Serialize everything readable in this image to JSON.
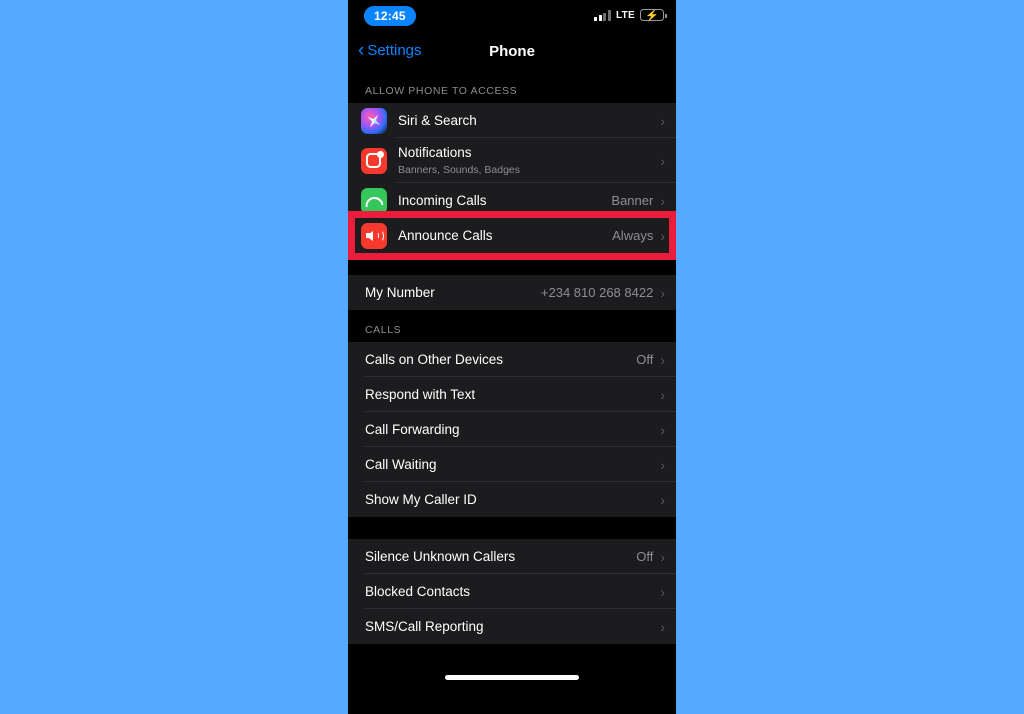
{
  "status_bar": {
    "time": "12:45",
    "carrier_network": "LTE",
    "signal_icon": "cellular-signal-icon",
    "battery_icon": "battery-charging-icon",
    "battery_color": "#32d74b"
  },
  "nav": {
    "back_label": "Settings",
    "back_icon": "chevron-left-icon",
    "title": "Phone"
  },
  "accent_color": "#0a84ff",
  "highlight_color": "#ec1c3d",
  "sections": [
    {
      "header": "ALLOW PHONE TO ACCESS",
      "rows": [
        {
          "icon": "siri-icon",
          "title": "Siri & Search",
          "subtitle": "",
          "value": ""
        },
        {
          "icon": "notifications-icon",
          "title": "Notifications",
          "subtitle": "Banners, Sounds, Badges",
          "value": ""
        },
        {
          "icon": "incoming-calls-icon",
          "title": "Incoming Calls",
          "subtitle": "",
          "value": "Banner"
        },
        {
          "icon": "announce-calls-icon",
          "title": "Announce Calls",
          "subtitle": "",
          "value": "Always"
        }
      ]
    },
    {
      "header": "",
      "rows": [
        {
          "icon": "",
          "title": "My Number",
          "subtitle": "",
          "value": "+234 810 268 8422"
        }
      ]
    },
    {
      "header": "CALLS",
      "rows": [
        {
          "icon": "",
          "title": "Calls on Other Devices",
          "subtitle": "",
          "value": "Off"
        },
        {
          "icon": "",
          "title": "Respond with Text",
          "subtitle": "",
          "value": ""
        },
        {
          "icon": "",
          "title": "Call Forwarding",
          "subtitle": "",
          "value": ""
        },
        {
          "icon": "",
          "title": "Call Waiting",
          "subtitle": "",
          "value": ""
        },
        {
          "icon": "",
          "title": "Show My Caller ID",
          "subtitle": "",
          "value": ""
        }
      ]
    },
    {
      "header": "",
      "rows": [
        {
          "icon": "",
          "title": "Silence Unknown Callers",
          "subtitle": "",
          "value": "Off"
        },
        {
          "icon": "",
          "title": "Blocked Contacts",
          "subtitle": "",
          "value": ""
        },
        {
          "icon": "",
          "title": "SMS/Call Reporting",
          "subtitle": "",
          "value": ""
        }
      ]
    }
  ],
  "chevron_glyph": "›",
  "back_chevron_glyph": "‹"
}
